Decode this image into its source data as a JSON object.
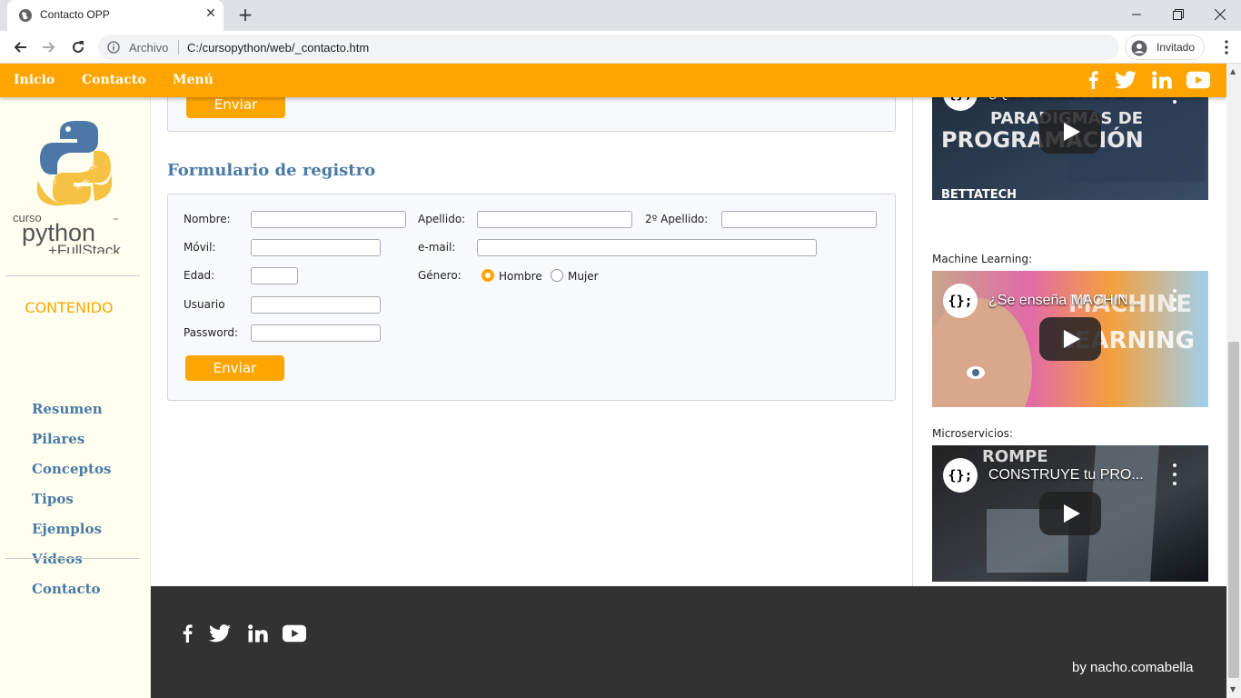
{
  "browser": {
    "tab_title": "Contacto OPP",
    "new_tab_symbol": "+",
    "close_symbol": "✕",
    "omnibox_label": "Archivo",
    "url": "C:/cursopython/web/_contacto.htm",
    "profile_label": "Invitado"
  },
  "site_nav": {
    "items": [
      {
        "label": "Inicio"
      },
      {
        "label": "Contacto"
      },
      {
        "label": "Menú"
      }
    ],
    "social_icons": [
      "facebook-icon",
      "twitter-icon",
      "linkedin-icon",
      "youtube-icon"
    ]
  },
  "sidebar": {
    "logo": {
      "line1": "curso",
      "line2": "python",
      "line3": "+FullStack",
      "tm": "™"
    },
    "heading": "CONTENIDO",
    "links": [
      {
        "label": "Resumen"
      },
      {
        "label": "Pilares"
      },
      {
        "label": "Conceptos"
      },
      {
        "label": "Tipos"
      },
      {
        "label": "Ejemplos"
      },
      {
        "label": "Vídeos"
      },
      {
        "label": "Contacto"
      }
    ]
  },
  "top_form": {
    "button_label": "Enviar"
  },
  "registration": {
    "title": "Formulario de registro",
    "labels": {
      "nombre": "Nombre:",
      "apellido": "Apellido:",
      "segundo_apellido": "2º Apellido:",
      "movil": "Móvil:",
      "email": "e-mail:",
      "edad": "Edad:",
      "genero": "Género:",
      "usuario": "Usuario",
      "password": "Password:"
    },
    "values": {
      "nombre": "",
      "apellido": "",
      "segundo_apellido": "",
      "movil": "",
      "email": "",
      "edad": "",
      "usuario": "",
      "password": ""
    },
    "gender_options": [
      {
        "label": "Hombre",
        "selected": true
      },
      {
        "label": "Mujer",
        "selected": false
      }
    ],
    "submit_label": "Enviar"
  },
  "videos": [
    {
      "caption": "",
      "title": "¿Qué son los PARADI...",
      "overlay": "PARADIGMAS DE PROGRAMACIÓN",
      "channel_text": "BETTATECH",
      "avatar": "{};"
    },
    {
      "caption": "Machine Learning:",
      "title": "¿Se enseña MACHIN...",
      "overlay": "MACHINE LEARNING",
      "avatar": "{};"
    },
    {
      "caption": "Microservicios:",
      "title": "CONSTRUYE tu PRO...",
      "overlay": "ROMPE",
      "avatar": "{};"
    }
  ],
  "footer": {
    "social_icons": [
      "facebook-icon",
      "twitter-icon",
      "linkedin-icon",
      "youtube-icon"
    ],
    "credit": "by nacho.comabella"
  },
  "colors": {
    "accent": "#ffa500",
    "link": "#4a7ba6",
    "footer_bg": "#323232",
    "sidebar_bg": "#fffff0"
  }
}
